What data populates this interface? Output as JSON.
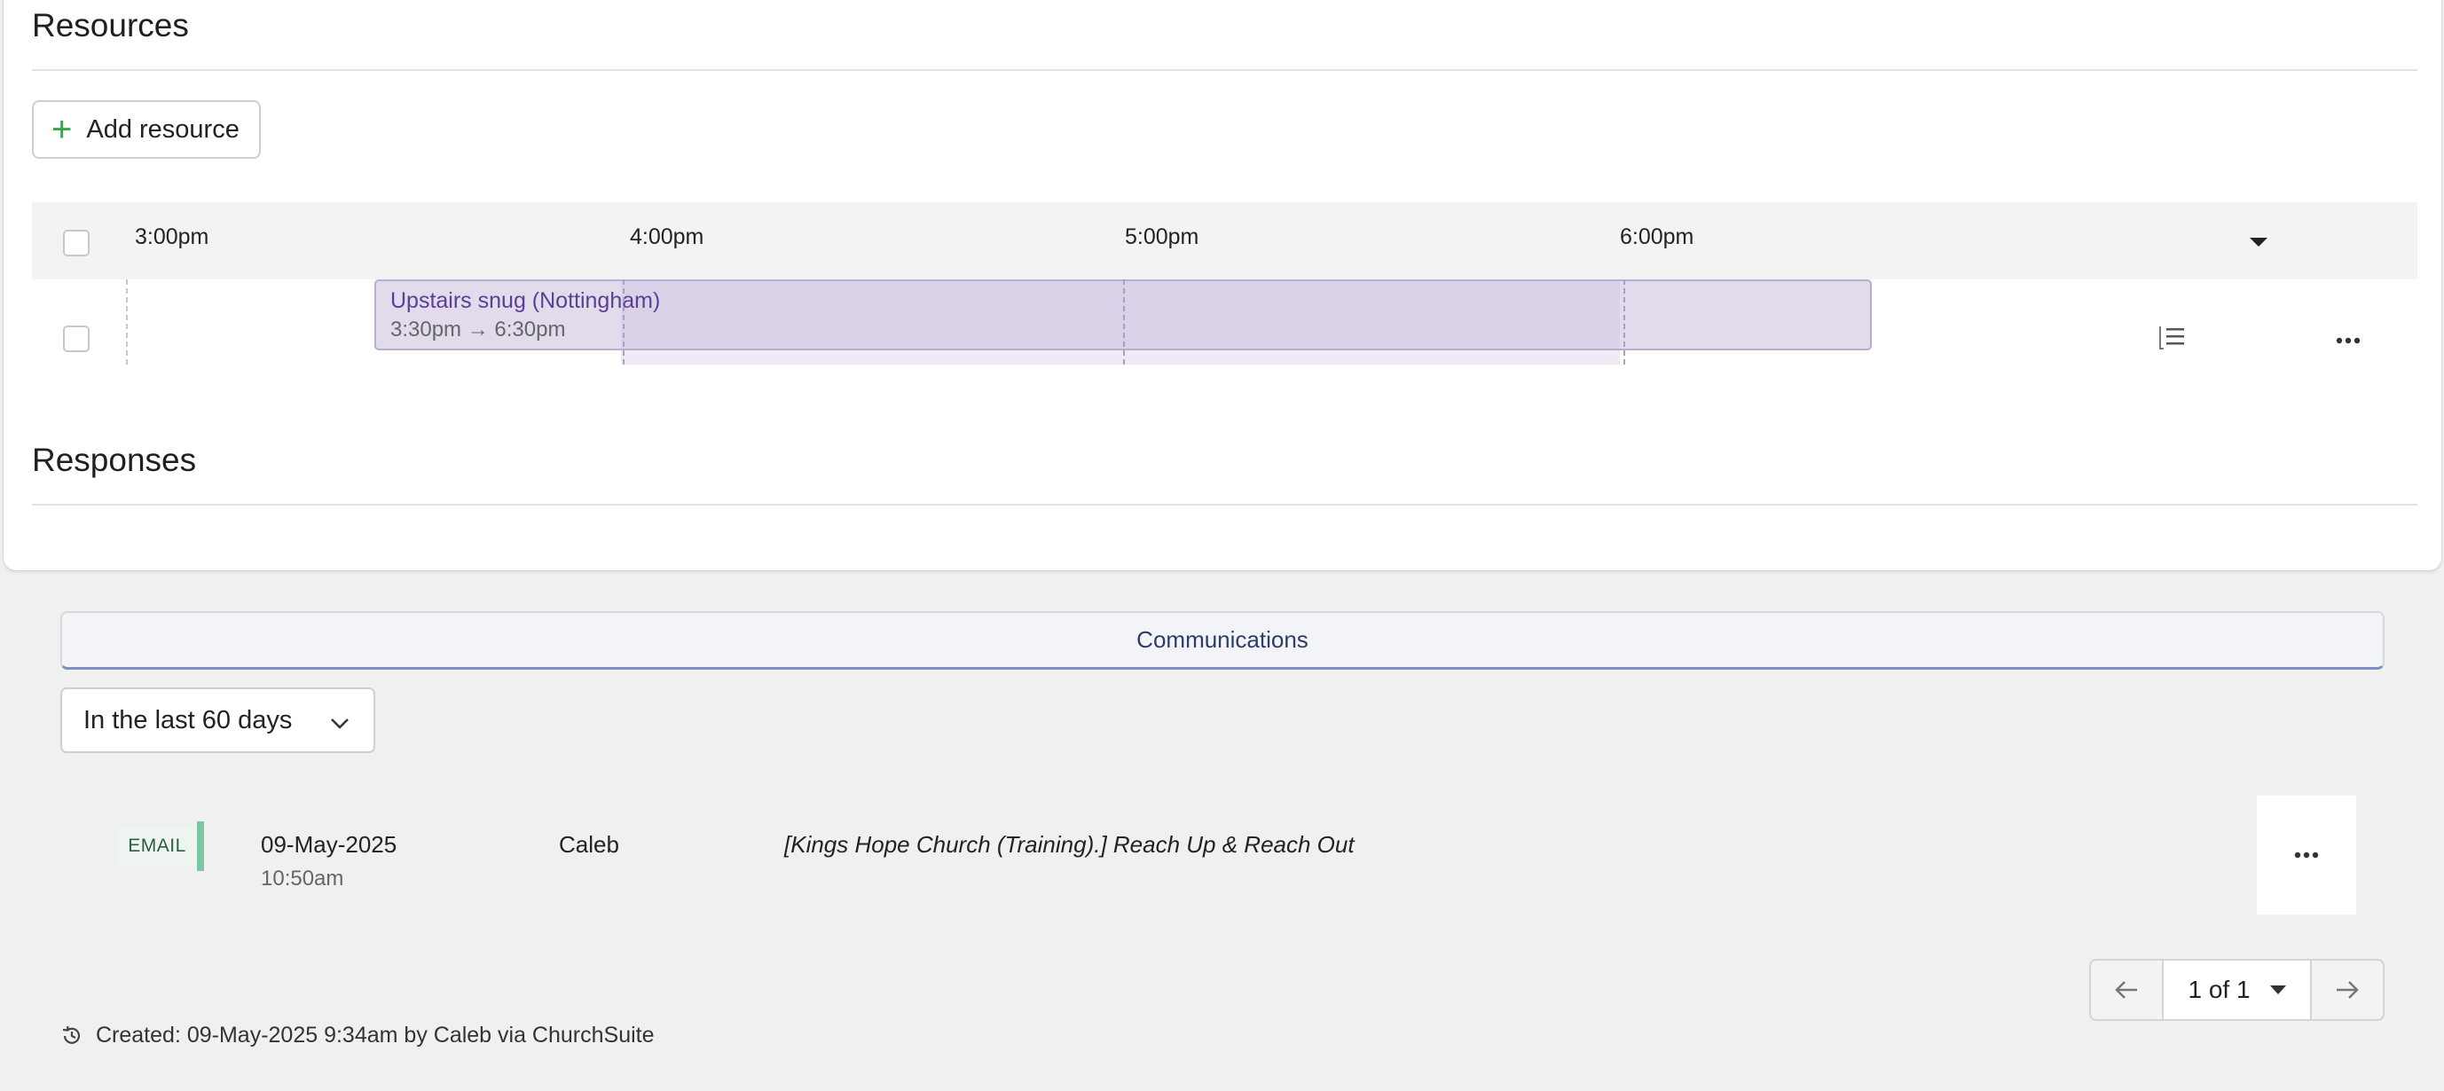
{
  "resources": {
    "title": "Resources",
    "add_label": "Add resource",
    "timeline": {
      "ticks": [
        "3:00pm",
        "4:00pm",
        "5:00pm",
        "6:00pm"
      ]
    },
    "booking": {
      "name": "Upstairs snug (Nottingham)",
      "time": "3:30pm → 6:30pm"
    }
  },
  "responses": {
    "title": "Responses"
  },
  "communications": {
    "tab_label": "Communications",
    "filter_value": "In the last 60 days",
    "items": [
      {
        "type": "EMAIL",
        "date": "09-May-2025",
        "time": "10:50am",
        "sender": "Caleb",
        "subject": "[Kings Hope Church (Training).] Reach Up & Reach Out"
      }
    ],
    "pager": {
      "label": "1 of 1"
    }
  },
  "footer": {
    "created": "Created: 09-May-2025 9:34am by Caleb via ChurchSuite"
  },
  "colors": {
    "accent_green": "#3aa34b",
    "booking_text": "#5b3f96",
    "email_bar": "#7cc7a4"
  }
}
